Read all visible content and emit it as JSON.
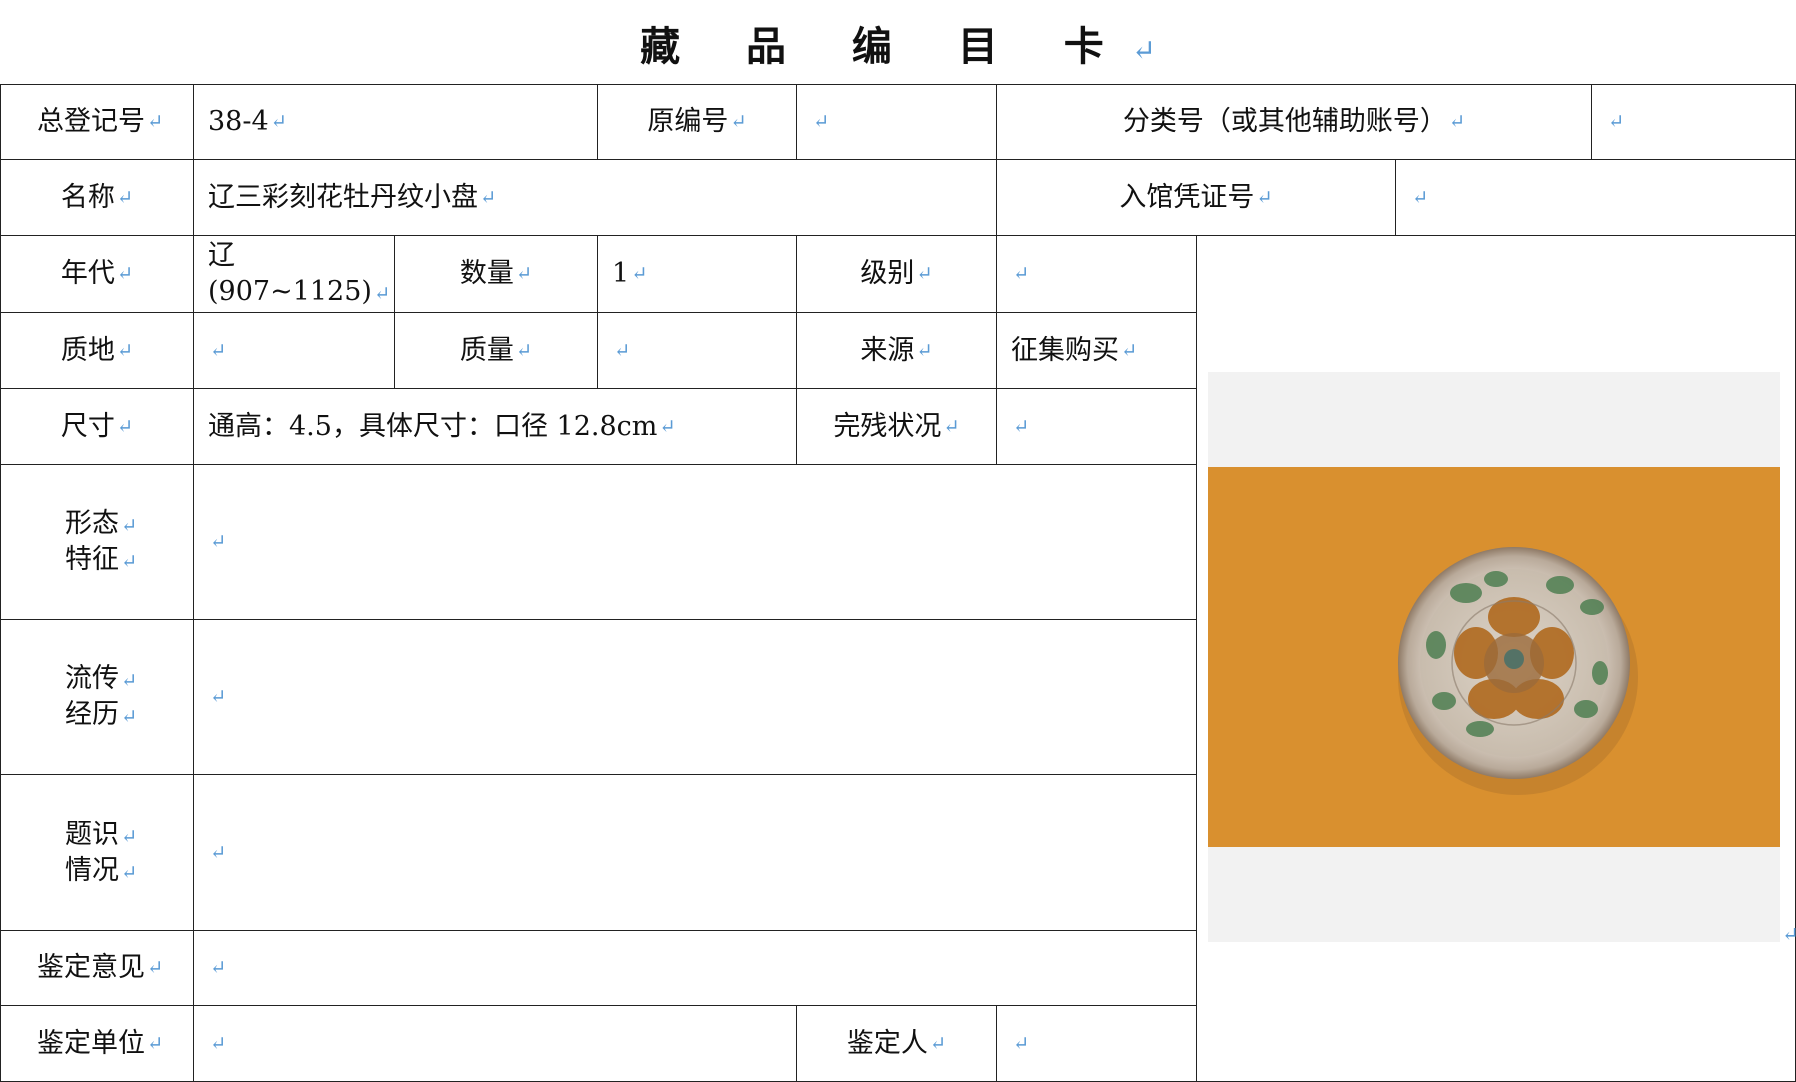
{
  "title": "藏 品 编 目 卡",
  "mark": "↵",
  "fields": {
    "zongdengji_label": "总登记号",
    "zongdengji_value": "38-4",
    "yuanbianhao_label": "原编号",
    "yuanbianhao_value": "",
    "fenleihao_label": "分类号（或其他辅助账号）",
    "fenleihao_value": "",
    "mingcheng_label": "名称",
    "mingcheng_value": "辽三彩刻花牡丹纹小盘",
    "ruguan_label": "入馆凭证号",
    "ruguan_value": "",
    "niandai_label": "年代",
    "niandai_value_line1": "辽",
    "niandai_value_line2": "(907~1125)",
    "shuliang_label": "数量",
    "shuliang_value": "1",
    "jibie_label": "级别",
    "jibie_value": "",
    "zhidi_label": "质地",
    "zhidi_value": "",
    "zhiliang_label": "质量",
    "zhiliang_value": "",
    "laiyuan_label": "来源",
    "laiyuan_value": "征集购买",
    "chicun_label": "尺寸",
    "chicun_value": "通高：4.5，具体尺寸：口径 12.8cm",
    "wancan_label": "完残状况",
    "wancan_value": "",
    "xingtai_label_1": "形态",
    "xingtai_label_2": "特征",
    "xingtai_value": "",
    "liuchuan_label_1": "流传",
    "liuchuan_label_2": "经历",
    "liuchuan_value": "",
    "tishi_label_1": "题识",
    "tishi_label_2": "情况",
    "tishi_value": "",
    "jianding_yijian_label": "鉴定意见",
    "jianding_yijian_value": "",
    "jianding_danwei_label": "鉴定单位",
    "jianding_danwei_value": "",
    "jianding_ren_label": "鉴定人",
    "jianding_ren_value": ""
  },
  "colors": {
    "border": "#222222",
    "paragraph_mark": "#5b9bd5",
    "photo_backdrop": "#f2f2f2",
    "plate_background": "#d9902f"
  }
}
